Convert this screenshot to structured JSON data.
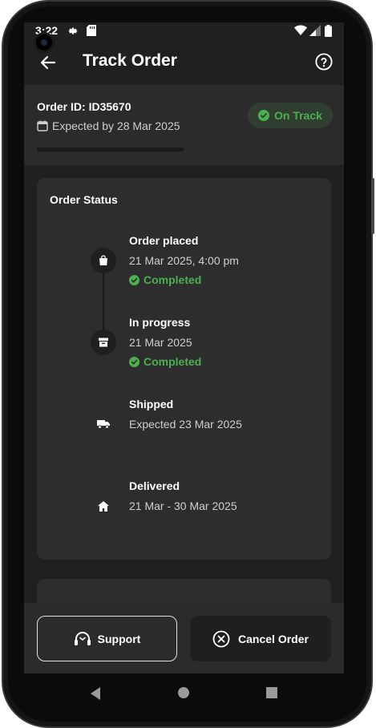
{
  "status_bar": {
    "time": "3:22"
  },
  "app_bar": {
    "title": "Track Order"
  },
  "order": {
    "id_text": "Order ID: ID35670",
    "expected_text": "Expected by 28 Mar 2025",
    "badge": "On Track",
    "progress_fraction": 0.0
  },
  "status_card": {
    "title": "Order Status",
    "steps": [
      {
        "title": "Order placed",
        "date": "21 Mar 2025, 4:00 pm",
        "state": "Completed",
        "icon": "shopping-bag-icon"
      },
      {
        "title": "In progress",
        "date": "21 Mar 2025",
        "state": "Completed",
        "icon": "archive-box-icon"
      },
      {
        "title": "Shipped",
        "date": "Expected 23 Mar 2025",
        "state": "",
        "icon": "truck-icon"
      },
      {
        "title": "Delivered",
        "date": "21 Mar - 30 Mar 2025",
        "state": "",
        "icon": "home-icon"
      }
    ]
  },
  "actions": {
    "support": "Support",
    "cancel": "Cancel Order"
  },
  "colors": {
    "accent": "#4caf50",
    "background": "#202020",
    "card": "#2d2d2d"
  }
}
